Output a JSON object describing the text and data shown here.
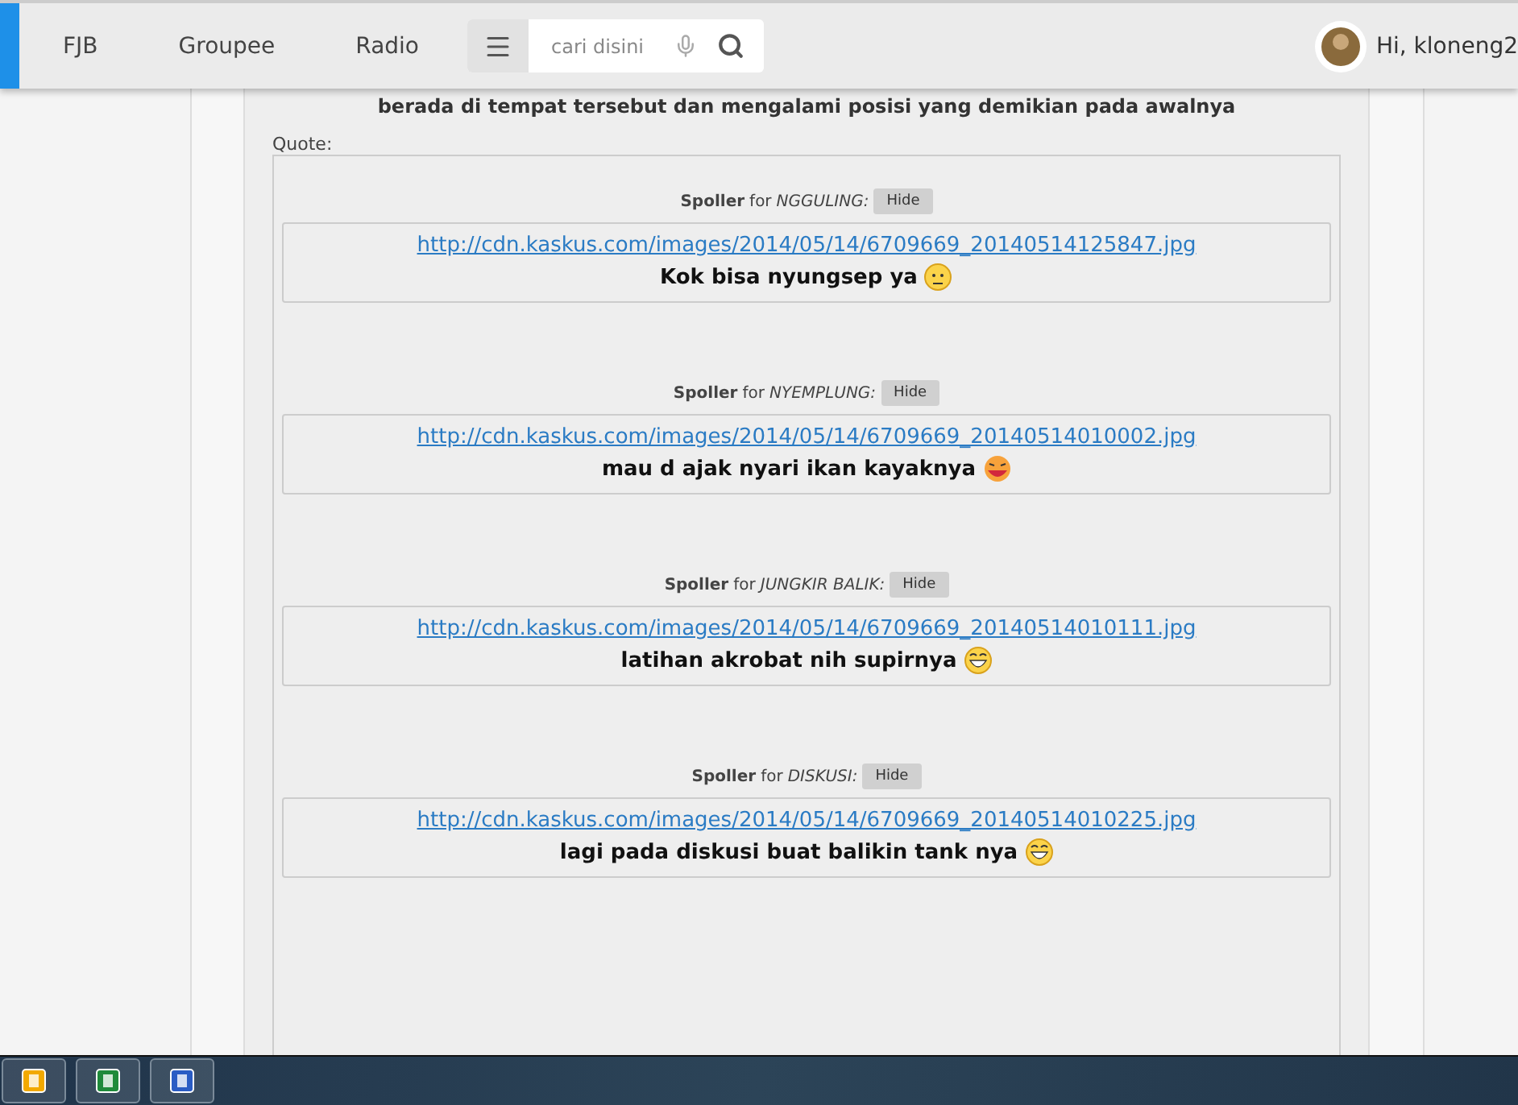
{
  "nav": {
    "items": [
      "FJB",
      "Groupee",
      "Radio"
    ],
    "search": {
      "placeholder": "cari disini"
    },
    "user": {
      "greeting": "Hi, kloneng2"
    }
  },
  "post": {
    "intro": "berada di tempat tersebut dan mengalami posisi yang demikian pada awalnya",
    "quote_label": "Quote:",
    "spoilers": [
      {
        "label": "Spoller",
        "for": "for",
        "title": "NGGULING:",
        "button": "Hide",
        "link": "http://cdn.kaskus.com/images/2014/05/14/6709669_20140514125847.jpg",
        "caption": "Kok bisa nyungsep ya",
        "emoji": {
          "kind": "confused"
        }
      },
      {
        "label": "Spoller",
        "for": "for",
        "title": "NYEMPLUNG:",
        "button": "Hide",
        "link": "http://cdn.kaskus.com/images/2014/05/14/6709669_20140514010002.jpg",
        "caption": "mau d ajak nyari ikan kayaknya",
        "emoji": {
          "kind": "laugh"
        }
      },
      {
        "label": "Spoller",
        "for": "for",
        "title": "JUNGKIR BALIK:",
        "button": "Hide",
        "link": "http://cdn.kaskus.com/images/2014/05/14/6709669_20140514010111.jpg",
        "caption": "latihan akrobat nih supirnya",
        "emoji": {
          "kind": "grin"
        }
      },
      {
        "label": "Spoller",
        "for": "for",
        "title": "DISKUSI:",
        "button": "Hide",
        "link": "http://cdn.kaskus.com/images/2014/05/14/6709669_20140514010225.jpg",
        "caption": "lagi pada diskusi buat balikin tank nya",
        "emoji": {
          "kind": "grin"
        }
      }
    ]
  },
  "taskbar": {
    "apps": [
      {
        "kind": "outlook"
      },
      {
        "kind": "excel"
      },
      {
        "kind": "word"
      }
    ]
  }
}
